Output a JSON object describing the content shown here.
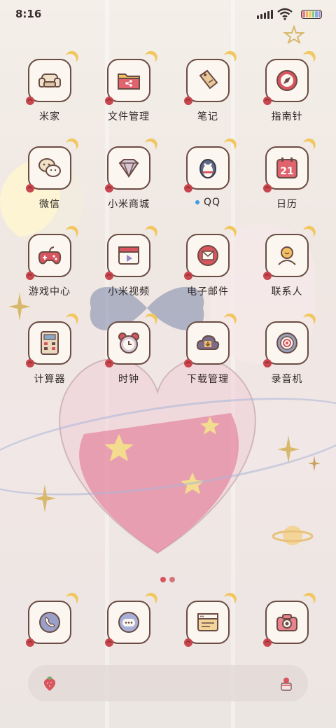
{
  "status_bar": {
    "time": "8:16"
  },
  "colors": {
    "icon_border": "#6a4c44",
    "icon_bg": "#fbf6ef",
    "crescent": "#f2c760",
    "rose": "#c8464d",
    "label": "#2d2525",
    "qq_dot": "#3a9be8"
  },
  "apps": [
    {
      "label": "米家",
      "icon": "armchair-icon"
    },
    {
      "label": "文件管理",
      "icon": "folder-icon"
    },
    {
      "label": "笔记",
      "icon": "tag-note-icon"
    },
    {
      "label": "指南针",
      "icon": "compass-icon"
    },
    {
      "label": "微信",
      "icon": "chat-bubbles-icon"
    },
    {
      "label": "小米商城",
      "icon": "gem-icon"
    },
    {
      "label": "QQ",
      "icon": "penguin-icon",
      "badge_dot": true
    },
    {
      "label": "日历",
      "icon": "calendar-icon",
      "calendar_day": "21"
    },
    {
      "label": "游戏中心",
      "icon": "gamepad-icon"
    },
    {
      "label": "小米视频",
      "icon": "video-icon"
    },
    {
      "label": "电子邮件",
      "icon": "envelope-icon"
    },
    {
      "label": "联系人",
      "icon": "contact-icon"
    },
    {
      "label": "计算器",
      "icon": "calculator-icon"
    },
    {
      "label": "时钟",
      "icon": "alarm-clock-icon"
    },
    {
      "label": "下载管理",
      "icon": "cloud-download-icon"
    },
    {
      "label": "录音机",
      "icon": "recorder-icon"
    }
  ],
  "dock": [
    {
      "icon": "phone-icon"
    },
    {
      "icon": "message-icon"
    },
    {
      "icon": "browser-icon"
    },
    {
      "icon": "camera-icon"
    }
  ],
  "search_bar": {
    "left_icon": "strawberry-icon",
    "right_icon": "strawberry-cake-icon"
  }
}
